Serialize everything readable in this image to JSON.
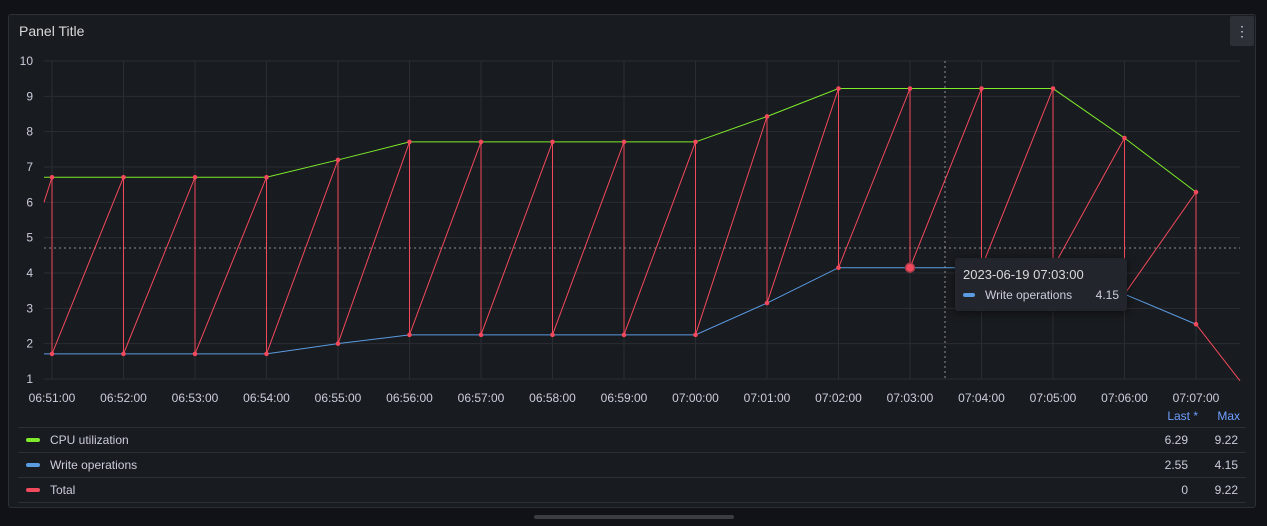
{
  "panel": {
    "title": "Panel Title"
  },
  "colors": {
    "cpu": "#7eec2b",
    "write": "#5b9be2",
    "total": "#f2495c",
    "grid": "#2a2d32"
  },
  "chart_data": {
    "type": "line",
    "ylim": [
      1,
      10
    ],
    "y_ticks": [
      "1",
      "2",
      "3",
      "4",
      "5",
      "6",
      "7",
      "8",
      "9",
      "10"
    ],
    "x": [
      "06:51:00",
      "06:52:00",
      "06:53:00",
      "06:54:00",
      "06:55:00",
      "06:56:00",
      "06:57:00",
      "06:58:00",
      "06:59:00",
      "07:00:00",
      "07:01:00",
      "07:02:00",
      "07:03:00",
      "07:04:00",
      "07:05:00",
      "07:06:00",
      "07:07:00"
    ],
    "series": [
      {
        "name": "CPU utilization",
        "values": [
          6.71,
          6.71,
          6.71,
          6.71,
          7.2,
          7.71,
          7.71,
          7.71,
          7.71,
          7.71,
          8.43,
          9.22,
          9.22,
          9.22,
          9.22,
          7.82,
          6.29
        ]
      },
      {
        "name": "Write operations",
        "values": [
          1.71,
          1.71,
          1.71,
          1.71,
          2.0,
          2.25,
          2.25,
          2.25,
          2.25,
          2.25,
          3.15,
          4.15,
          4.15,
          4.15,
          4.15,
          3.4,
          2.55
        ]
      }
    ],
    "total_note": "Total series alternates between CPU and Write values at each timestamp",
    "hover_x": "07:03:00"
  },
  "tooltip": {
    "time": "2023-06-19 07:03:00",
    "series": "Write operations",
    "value": "4.15"
  },
  "legend": {
    "header_last": "Last *",
    "header_max": "Max",
    "rows": [
      {
        "name": "CPU utilization",
        "last": "6.29",
        "max": "9.22"
      },
      {
        "name": "Write operations",
        "last": "2.55",
        "max": "4.15"
      },
      {
        "name": "Total",
        "last": "0",
        "max": "9.22"
      }
    ]
  }
}
